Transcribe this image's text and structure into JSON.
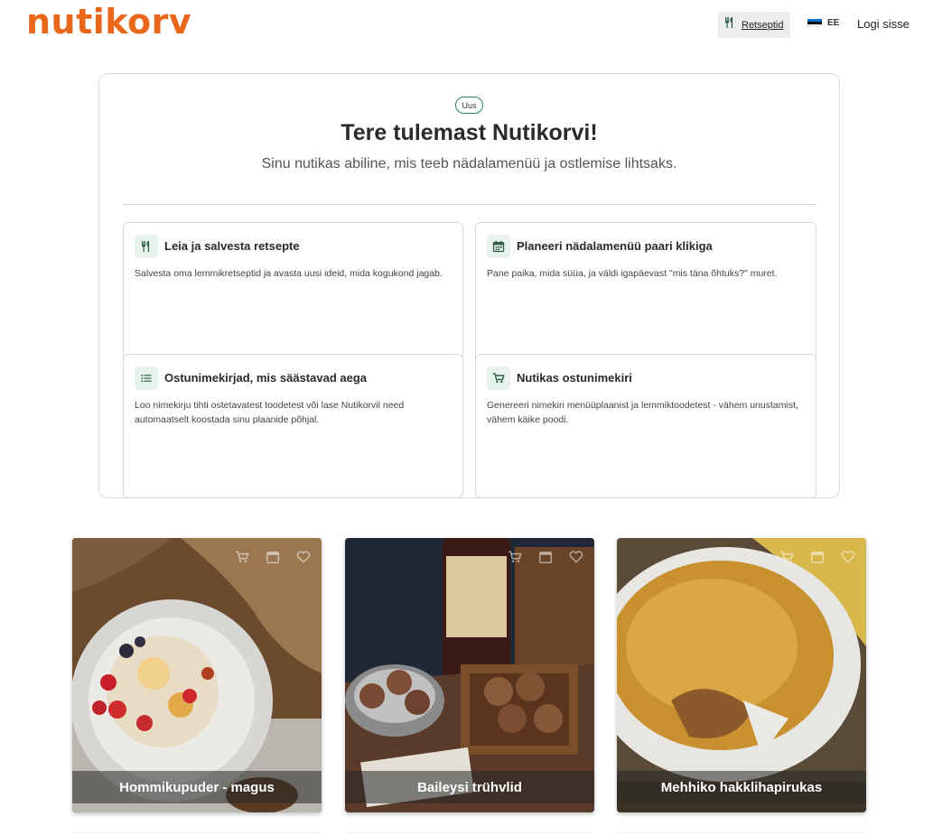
{
  "header": {
    "logo": "nutikorv",
    "nav_recipes": "Retseptid",
    "lang_code": "EE",
    "login": "Logi sisse"
  },
  "hero": {
    "badge": "Uus",
    "title": "Tere tulemast Nutikorvi!",
    "subtitle": "Sinu nutikas abiline, mis teeb nädalamenüü ja ostlemise lihtsaks."
  },
  "features": [
    {
      "icon": "utensils-icon",
      "title": "Leia ja salvesta retsepte",
      "desc": "Salvesta oma lemmikretseptid ja avasta uusi ideid, mida kogukond jagab."
    },
    {
      "icon": "calendar-icon",
      "title": "Planeeri nädalamenüü paari klikiga",
      "desc": "Pane paika, mida süüa, ja väldi igapäevast \"mis täna õhtuks?\" muret."
    },
    {
      "icon": "list-icon",
      "title": "Ostunimekirjad, mis säästavad aega",
      "desc": "Loo nimekirju tihti ostetavatest toodetest või lase Nutikorvil need automaatselt koostada sinu plaanide põhjal."
    },
    {
      "icon": "cart-icon",
      "title": "Nutikas ostunimekiri",
      "desc": "Genereeri nimekiri menüüplaanist ja lemmiktoodetest - vähem unustamist, vähem käike poodi."
    }
  ],
  "recipes": [
    {
      "title": "Hommikupuder - magus"
    },
    {
      "title": "Baileysi trühvlid"
    },
    {
      "title": "Mehhiko hakklihapirukas"
    }
  ],
  "colors": {
    "brand": "#e8671a",
    "accent_green": "#2e7d5b"
  }
}
